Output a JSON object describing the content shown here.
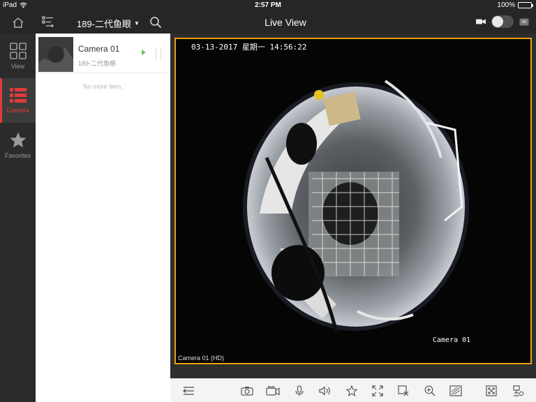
{
  "status_bar": {
    "device": "iPad",
    "time": "2:57 PM",
    "battery": "100%"
  },
  "header": {
    "device_selector": "189-二代鱼眼",
    "title": "Live View"
  },
  "nav": {
    "items": [
      {
        "label": "View",
        "icon": "grid-icon",
        "active": false
      },
      {
        "label": "Camera",
        "icon": "camera-list-icon",
        "active": true
      },
      {
        "label": "Favorites",
        "icon": "star-icon",
        "active": false
      }
    ]
  },
  "camera_list": {
    "items": [
      {
        "name": "Camera 01",
        "device": "189-二代鱼眼"
      }
    ],
    "end_text": "No more item."
  },
  "video": {
    "osd_timestamp": "03-13-2017 星期一 14:56:22",
    "osd_camera_name": "Camera 01",
    "label": "Camera 01 (HD)"
  },
  "toolbar": {
    "buttons": [
      "collapse-icon",
      "capture-icon",
      "record-icon",
      "microphone-icon",
      "audio-icon",
      "favorite-icon",
      "fullscreen-icon",
      "close-window-icon",
      "zoom-icon",
      "fisheye-icon",
      "ptz-icon",
      "settings-icon"
    ]
  },
  "colors": {
    "accent": "#e03a3a",
    "selected_frame": "#e8a20c",
    "play": "#5ec85e",
    "battery": "#4cd964"
  }
}
